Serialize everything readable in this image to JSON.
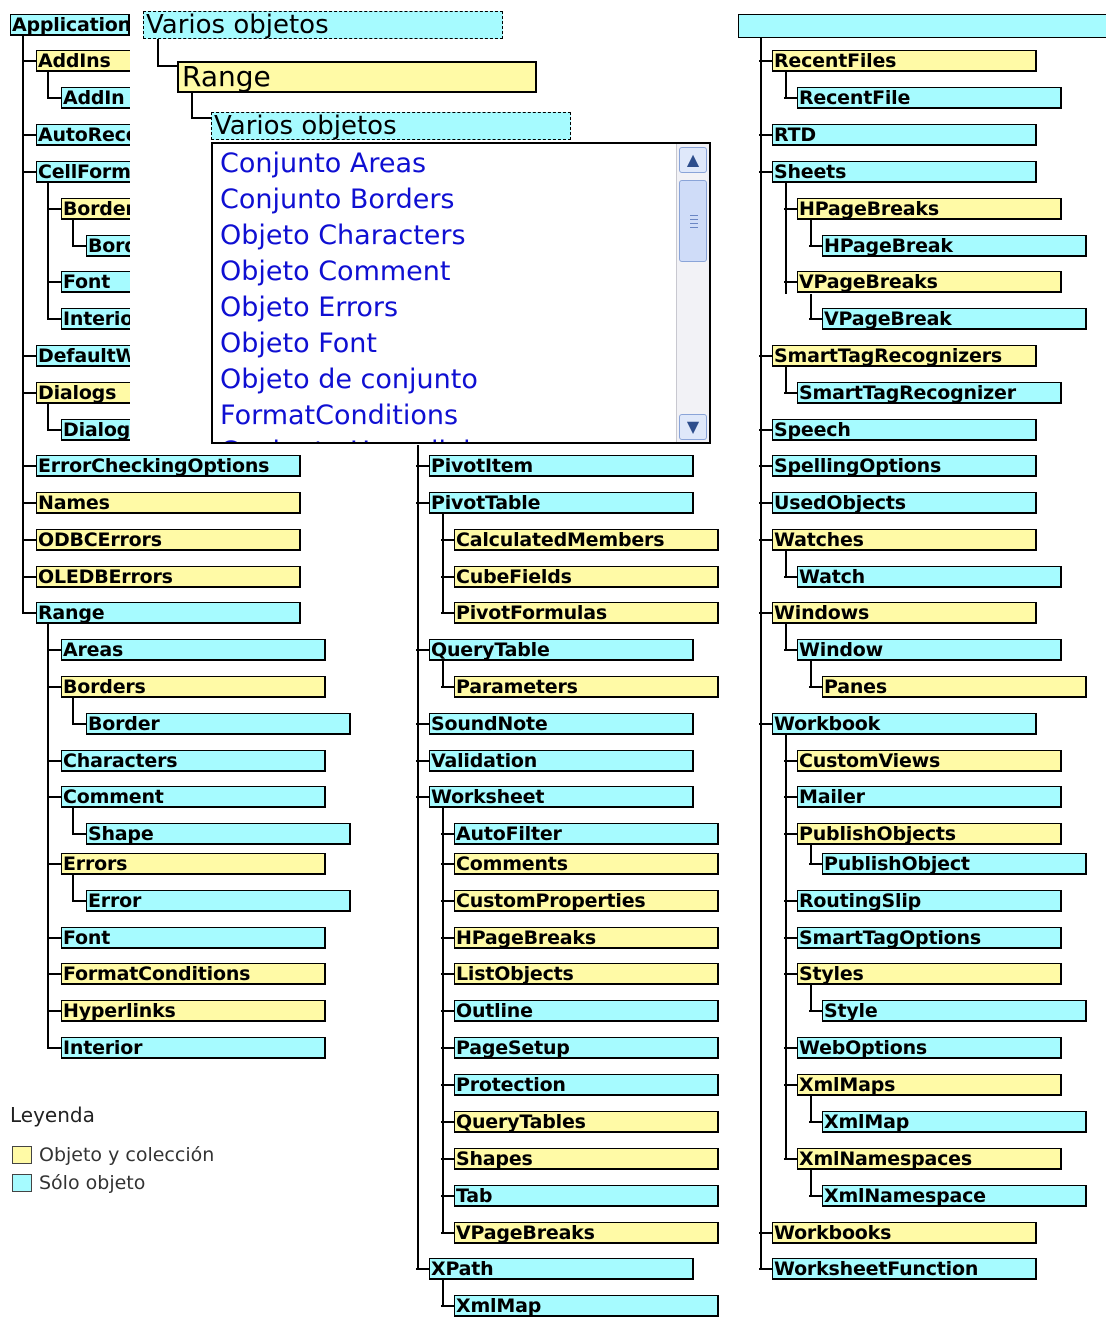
{
  "colors": {
    "collection": "#fffaa6",
    "object": "#a6fbff",
    "link": "#0f0fd2"
  },
  "tree": {
    "col1": {
      "root": "Application",
      "items": [
        "AddIns",
        "AddIn",
        "AutoRecover",
        "CellFormat",
        "Borders",
        "Border",
        "Font",
        "Interior",
        "DefaultWebOptions",
        "Dialogs",
        "Dialog",
        "ErrorCheckingOptions",
        "Names",
        "ODBCErrors",
        "OLEDBErrors",
        "Range",
        "Areas",
        "Borders",
        "Border",
        "Characters",
        "Comment",
        "Shape",
        "Errors",
        "Error",
        "Font",
        "FormatConditions",
        "Hyperlinks",
        "Interior"
      ]
    },
    "col2": {
      "items": [
        "PivotItem",
        "PivotTable",
        "CalculatedMembers",
        "CubeFields",
        "PivotFormulas",
        "QueryTable",
        "Parameters",
        "SoundNote",
        "Validation",
        "Worksheet",
        "AutoFilter",
        "Comments",
        "CustomProperties",
        "HPageBreaks",
        "ListObjects",
        "Outline",
        "PageSetup",
        "Protection",
        "QueryTables",
        "Shapes",
        "Tab",
        "VPageBreaks",
        "XPath",
        "XmlMap"
      ]
    },
    "col3": {
      "items": [
        "RecentFiles",
        "RecentFile",
        "RTD",
        "Sheets",
        "HPageBreaks",
        "HPageBreak",
        "VPageBreaks",
        "VPageBreak",
        "SmartTagRecognizers",
        "SmartTagRecognizer",
        "Speech",
        "SpellingOptions",
        "UsedObjects",
        "Watches",
        "Watch",
        "Windows",
        "Window",
        "Panes",
        "Workbook",
        "CustomViews",
        "Mailer",
        "PublishObjects",
        "PublishObject",
        "RoutingSlip",
        "SmartTagOptions",
        "Styles",
        "Style",
        "WebOptions",
        "XmlMaps",
        "XmlMap",
        "XmlNamespaces",
        "XmlNamespace",
        "Workbooks",
        "WorksheetFunction"
      ]
    }
  },
  "popup": {
    "header1": "Varios objetos",
    "range": "Range",
    "header2": "Varios objetos",
    "list": [
      "Conjunto Areas",
      "Conjunto Borders",
      "Objeto Characters",
      "Objeto Comment",
      "Objeto Errors",
      "Objeto Font",
      "Objeto de conjunto",
      "FormatConditions",
      "Conjunto Hyperlinks"
    ]
  },
  "legend": {
    "title": "Leyenda",
    "items": [
      {
        "label": "Objeto y colección",
        "color": "#fffaa6"
      },
      {
        "label": "Sólo objeto",
        "color": "#a6fbff"
      }
    ]
  }
}
